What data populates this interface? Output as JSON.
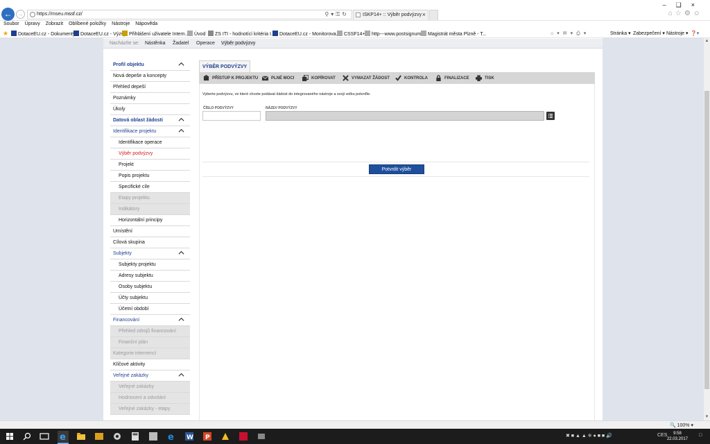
{
  "browser": {
    "url_prefix": "https://mseu.",
    "url_domain": "mssf.cz/",
    "tab_title": "ISKP14+ :: Výběr podvýzvy",
    "menu": [
      "Soubor",
      "Úpravy",
      "Zobrazit",
      "Oblíbené položky",
      "Nástroje",
      "Nápověda"
    ],
    "favorites": [
      "DotaceEU.cz - Dokumenty",
      "DotaceEU.cz - Výzvy",
      "Přihlášení uživatele Intern...",
      "Úvod",
      "ZS ITI - hodnotící kritéria I...",
      "DotaceEU.cz - Monitorova...",
      "CSSF14+",
      "http---www.postsignum",
      "Magistrát města Plzně - T..."
    ],
    "right_tools": [
      "Stránka",
      "Zabezpečení",
      "Nástroje"
    ],
    "zoom": "100%"
  },
  "breadcrumb": {
    "label": "Nacházíte se:",
    "items": [
      "Nástěnka",
      "Žadatel",
      "Operace",
      "Výběr podvýzvy"
    ]
  },
  "sidebar": {
    "items": [
      {
        "label": "Profil objektu",
        "type": "head",
        "chevron": true
      },
      {
        "label": "Nová depeše a koncepty",
        "type": "item"
      },
      {
        "label": "Přehled depeší",
        "type": "item"
      },
      {
        "label": "Poznámky",
        "type": "item"
      },
      {
        "label": "Úkoly",
        "type": "item"
      },
      {
        "label": "Datová oblast žádosti",
        "type": "head",
        "chevron": true
      },
      {
        "label": "Identifikace projektu",
        "type": "headplain",
        "chevron": true
      },
      {
        "label": "Identifikace operace",
        "type": "sub"
      },
      {
        "label": "Výběr podvýzvy",
        "type": "sub-selected"
      },
      {
        "label": "Projekt",
        "type": "sub"
      },
      {
        "label": "Popis projektu",
        "type": "sub"
      },
      {
        "label": "Specifické cíle",
        "type": "sub"
      },
      {
        "label": "Etapy projektu",
        "type": "sub-disabled"
      },
      {
        "label": "Indikátory",
        "type": "sub-disabled"
      },
      {
        "label": "Horizontální principy",
        "type": "sub"
      },
      {
        "label": "Umístění",
        "type": "item"
      },
      {
        "label": "Cílová skupina",
        "type": "item"
      },
      {
        "label": "Subjekty",
        "type": "headplain",
        "chevron": true
      },
      {
        "label": "Subjekty projektu",
        "type": "sub"
      },
      {
        "label": "Adresy subjektu",
        "type": "sub"
      },
      {
        "label": "Osoby subjektu",
        "type": "sub"
      },
      {
        "label": "Účty subjektu",
        "type": "sub"
      },
      {
        "label": "Účetní období",
        "type": "sub"
      },
      {
        "label": "Financování",
        "type": "headplain",
        "chevron": true
      },
      {
        "label": "Přehled zdrojů financování",
        "type": "sub-disabled"
      },
      {
        "label": "Finanční plán",
        "type": "sub-disabled"
      },
      {
        "label": "Kategorie intervencí",
        "type": "disabled"
      },
      {
        "label": "Klíčové aktivity",
        "type": "item"
      },
      {
        "label": "Veřejné zakázky",
        "type": "headplain",
        "chevron": true
      },
      {
        "label": "Veřejné zakázky",
        "type": "sub-disabled"
      },
      {
        "label": "Hodnocení a odvolání",
        "type": "sub-disabled"
      },
      {
        "label": "Veřejné zakázky - etapy",
        "type": "sub-disabled"
      }
    ]
  },
  "content": {
    "title": "VÝBĚR PODVÝZVY",
    "toolbar": {
      "access": "PŘÍSTUP K PROJEKTU",
      "power": "PLNÉ MOCI",
      "copy": "KOPÍROVAT",
      "delete": "VYMAZAT ŽÁDOST",
      "check": "KONTROLA",
      "finalize": "FINALIZACE",
      "print": "TISK"
    },
    "info_text": "Vyberte podvýzvu, ve které chcete podávat žádost do integrovaného nástroje a svoji volbu potvrďte.",
    "number_label": "ČÍSLO PODVÝZVY",
    "number_value": "",
    "name_label": "NÁZEV PODVÝZVY",
    "name_value": "",
    "confirm_label": "Potvrdit výběr"
  },
  "taskbar": {
    "language": "CES",
    "time": "9:58",
    "date": "22.03.2017"
  }
}
